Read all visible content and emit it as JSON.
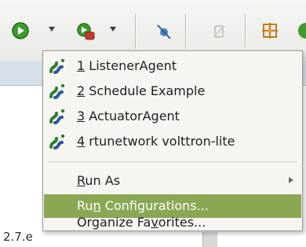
{
  "toolbar": {
    "run_icon": "run-green-circle-icon",
    "run_dropdown_icon": "dropdown-arrow-icon",
    "debug_icon": "external-tools-icon",
    "skip_icon": "skip-breakpoints-icon",
    "disabled_icon": "disabled-tool-icon",
    "open_type_icon": "open-type-icon"
  },
  "menu": {
    "items": [
      {
        "number": "1",
        "label": " ListenerAgent",
        "icon": "python-launch-icon"
      },
      {
        "number": "2",
        "label": " Schedule Example",
        "icon": "python-launch-icon"
      },
      {
        "number": "3",
        "label": " ActuatorAgent",
        "icon": "python-launch-icon"
      },
      {
        "number": "4",
        "label": " rtunetwork volttron-lite",
        "icon": "python-launch-icon"
      }
    ],
    "run_as": {
      "mnemonic": "R",
      "rest": "un As"
    },
    "run_configurations": {
      "pre": "Ru",
      "mnemonic": "n",
      "rest": " Configurations..."
    },
    "organize_favorites": {
      "pre": "Organize Fa",
      "mnemonic": "v",
      "rest": "orites..."
    }
  },
  "background": {
    "partial_text": "2.7.e"
  },
  "colors": {
    "highlight": "#8aa754",
    "menu_bg": "#f6f5f2"
  }
}
